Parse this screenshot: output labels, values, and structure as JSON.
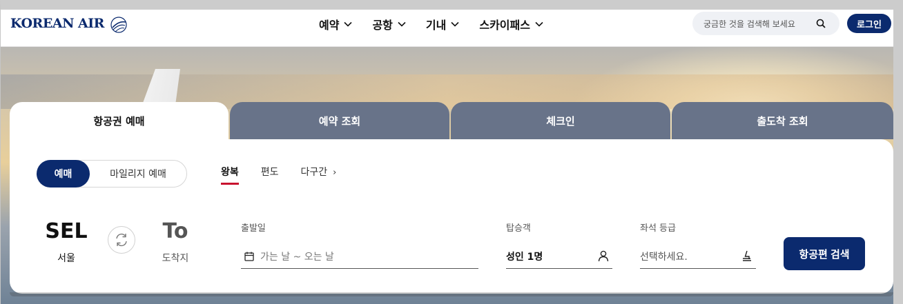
{
  "header": {
    "logo_text": "KOREAN AIR",
    "nav": [
      {
        "label": "예약"
      },
      {
        "label": "공항"
      },
      {
        "label": "기내"
      },
      {
        "label": "스카이패스"
      }
    ],
    "search_placeholder": "궁금한 것을 검색해 보세요",
    "login_label": "로그인"
  },
  "tabs": [
    {
      "label": "항공권 예매",
      "active": true
    },
    {
      "label": "예약 조회",
      "active": false
    },
    {
      "label": "체크인",
      "active": false
    },
    {
      "label": "출도착 조회",
      "active": false
    }
  ],
  "booking": {
    "mode_active": "예매",
    "mode_other": "마일리지 예매",
    "trip_types": [
      {
        "label": "왕복",
        "active": true
      },
      {
        "label": "편도",
        "active": false
      },
      {
        "label": "다구간",
        "active": false
      }
    ],
    "multi_arrow": "›",
    "origin": {
      "code": "SEL",
      "name": "서울"
    },
    "destination": {
      "code": "To",
      "name": "도착지"
    },
    "departure_label": "출발일",
    "departure_placeholder": "가는 날 ~ 오는 날",
    "passenger_label": "탑승객",
    "passenger_value": "성인 1명",
    "class_label": "좌석 등급",
    "class_placeholder": "선택하세요.",
    "search_button": "항공편 검색"
  },
  "colors": {
    "brand_navy": "#0b2a6e",
    "tab_inactive": "#687389",
    "active_underline": "#c8102e"
  },
  "icons": {
    "nav_chevron": "chevron-down-icon",
    "search": "search-icon",
    "swap": "swap-icon",
    "calendar": "calendar-icon",
    "passenger": "person-icon",
    "seat": "seat-icon"
  }
}
